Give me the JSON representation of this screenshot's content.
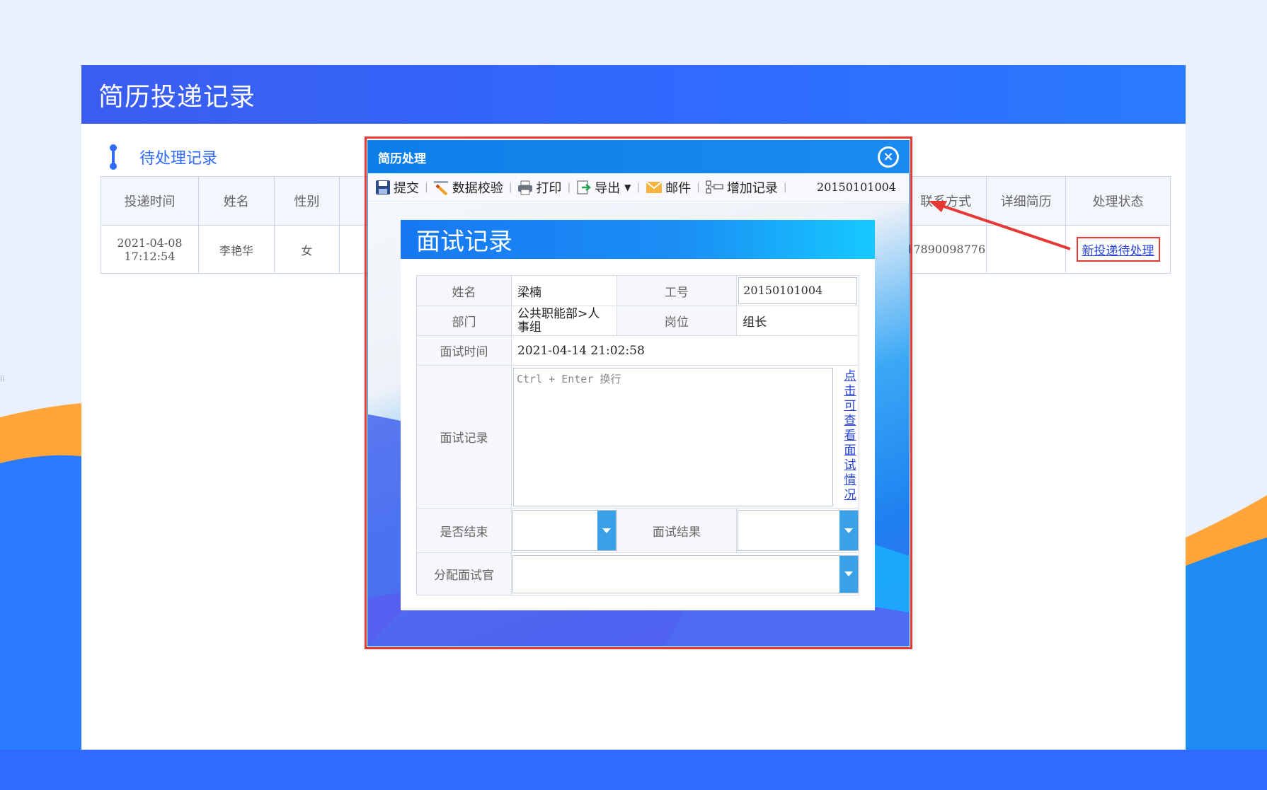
{
  "page": {
    "title": "简历投递记录",
    "section_title": "待处理记录",
    "table": {
      "headers": [
        "投递时间",
        "姓名",
        "性别",
        "联系方式",
        "详细简历",
        "处理状态"
      ],
      "rows": [
        {
          "time_line1": "2021-04-08",
          "time_line2": "17:12:54",
          "name": "李艳华",
          "gender": "女",
          "contact": "17890098776",
          "detail": "",
          "status": "新投递待处理"
        }
      ]
    }
  },
  "dialog": {
    "title": "简历处理",
    "toolbar": {
      "submit": "提交",
      "validate": "数据校验",
      "print": "打印",
      "export": "导出",
      "mail": "邮件",
      "add_record": "增加记录",
      "code": "20150101004"
    },
    "form": {
      "title": "面试记录",
      "name_label": "姓名",
      "name_value": "梁楠",
      "id_label": "工号",
      "id_value": "20150101004",
      "dept_label": "部门",
      "dept_value": "公共职能部>人事组",
      "post_label": "岗位",
      "post_value": "组长",
      "time_label": "面试时间",
      "time_value": "2021-04-14 21:02:58",
      "record_label": "面试记录",
      "record_placeholder": "Ctrl + Enter 换行",
      "view_link": "点击可查看面试情况",
      "finished_label": "是否结束",
      "finished_value": "",
      "result_label": "面试结果",
      "result_value": "",
      "assign_label": "分配面试官",
      "assign_value": ""
    }
  },
  "colors": {
    "brand_blue": "#2f6bff",
    "annotation_red": "#e53935",
    "accent_orange": "#ffa53a"
  }
}
